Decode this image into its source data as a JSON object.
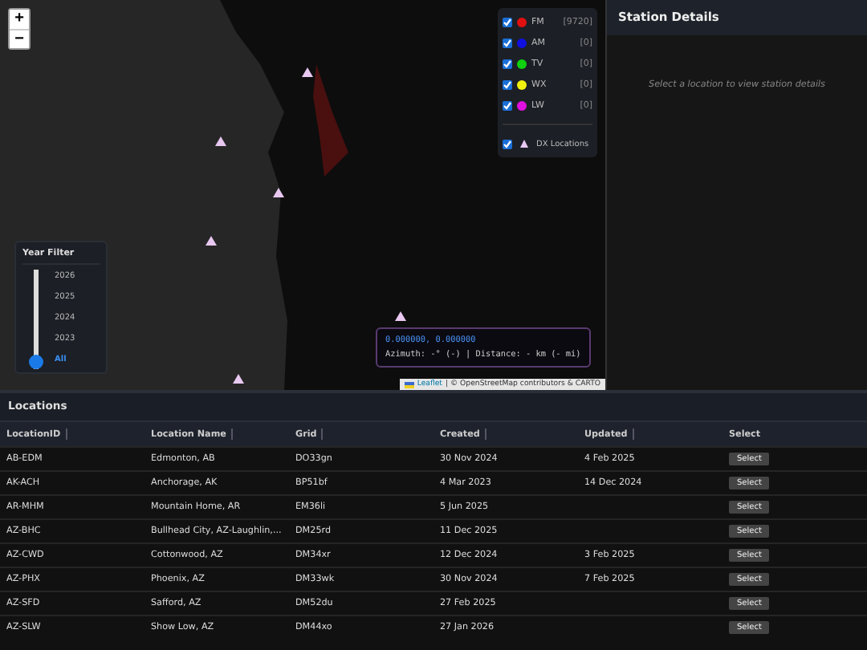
{
  "map": {
    "zoom_in": "+",
    "zoom_out": "−",
    "legend": [
      {
        "label": "FM",
        "count": "[9720]",
        "color": "#e01010",
        "checked": true,
        "kind": "band"
      },
      {
        "label": "AM",
        "count": "[0]",
        "color": "#1010e0",
        "checked": true,
        "kind": "band"
      },
      {
        "label": "TV",
        "count": "[0]",
        "color": "#10d010",
        "checked": true,
        "kind": "band"
      },
      {
        "label": "WX",
        "count": "[0]",
        "color": "#f0f010",
        "checked": true,
        "kind": "band"
      },
      {
        "label": "LW",
        "count": "[0]",
        "color": "#e010e0",
        "checked": true,
        "kind": "band"
      },
      {
        "label": "DX Locations",
        "checked": true,
        "kind": "dx"
      }
    ],
    "year_filter": {
      "title": "Year Filter",
      "options": [
        {
          "label": "2026",
          "selected": false
        },
        {
          "label": "2025",
          "selected": false
        },
        {
          "label": "2024",
          "selected": false
        },
        {
          "label": "2023",
          "selected": false
        },
        {
          "label": "All",
          "selected": true
        }
      ]
    },
    "coordinates": "0.000000, 0.000000",
    "bearing": "Azimuth: -° (-) | Distance: - km (- mi)",
    "attribution_link": "Leaflet",
    "attribution": "| © OpenStreetMap contributors & CARTO"
  },
  "station_details": {
    "title": "Station Details",
    "empty_message": "Select a location to view station details"
  },
  "locations": {
    "title": "Locations",
    "columns": [
      {
        "label": "LocationID",
        "sortable": true
      },
      {
        "label": "Location Name",
        "sortable": true
      },
      {
        "label": "Grid",
        "sortable": true
      },
      {
        "label": "Created",
        "sortable": true
      },
      {
        "label": "Updated",
        "sortable": true
      },
      {
        "label": "Select",
        "sortable": false
      }
    ],
    "rows": [
      {
        "id": "AB-EDM",
        "name": "Edmonton, AB",
        "grid": "DO33gn",
        "created": "30 Nov 2024",
        "updated": "4 Feb 2025",
        "action": "Select"
      },
      {
        "id": "AK-ACH",
        "name": "Anchorage, AK",
        "grid": "BP51bf",
        "created": "4 Mar 2023",
        "updated": "14 Dec 2024",
        "action": "Select"
      },
      {
        "id": "AR-MHM",
        "name": "Mountain Home, AR",
        "grid": "EM36li",
        "created": "5 Jun 2025",
        "updated": "",
        "action": "Select"
      },
      {
        "id": "AZ-BHC",
        "name": "Bullhead City, AZ-Laughlin,...",
        "grid": "DM25rd",
        "created": "11 Dec 2025",
        "updated": "",
        "action": "Select"
      },
      {
        "id": "AZ-CWD",
        "name": "Cottonwood, AZ",
        "grid": "DM34xr",
        "created": "12 Dec 2024",
        "updated": "3 Feb 2025",
        "action": "Select"
      },
      {
        "id": "AZ-PHX",
        "name": "Phoenix, AZ",
        "grid": "DM33wk",
        "created": "30 Nov 2024",
        "updated": "7 Feb 2025",
        "action": "Select"
      },
      {
        "id": "AZ-SFD",
        "name": "Safford, AZ",
        "grid": "DM52du",
        "created": "27 Feb 2025",
        "updated": "",
        "action": "Select"
      },
      {
        "id": "AZ-SLW",
        "name": "Show Low, AZ",
        "grid": "DM44xo",
        "created": "27 Jan 2026",
        "updated": "",
        "action": "Select"
      }
    ]
  }
}
